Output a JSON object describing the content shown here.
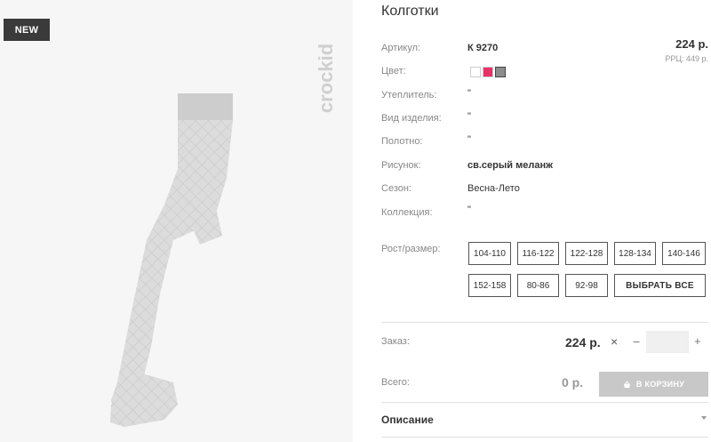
{
  "badge": {
    "label": "NEW"
  },
  "brand": {
    "logo_text": "crockid"
  },
  "product": {
    "title": "Колготки",
    "price": "224 р.",
    "rrp": "РРЦ: 449 р."
  },
  "attributes": [
    {
      "label": "Артикул:",
      "value": "К 9270"
    },
    {
      "label": "Цвет:",
      "value": ""
    },
    {
      "label": "Утеплитель:",
      "value": "\""
    },
    {
      "label": "Вид изделия:",
      "value": "\""
    },
    {
      "label": "Полотно:",
      "value": "\""
    },
    {
      "label": "Рисунок:",
      "value": "св.серый меланж"
    },
    {
      "label": "Сезон:",
      "value": "Весна-Лето"
    },
    {
      "label": "Коллекция:",
      "value": "\""
    }
  ],
  "colors": [
    {
      "name": "white",
      "hex": "#ffffff"
    },
    {
      "name": "pink",
      "hex": "#e8326a"
    },
    {
      "name": "gray",
      "hex": "#8d8d8d"
    }
  ],
  "sizes": {
    "label": "Рост/размер:",
    "options": [
      "104-110",
      "116-122",
      "122-128",
      "128-134",
      "140-146",
      "152-158",
      "80-86",
      "92-98"
    ],
    "select_all": "ВЫБРАТЬ ВСЕ"
  },
  "order": {
    "label": "Заказ:",
    "price": "224 р.",
    "times": "×",
    "minus": "−",
    "plus": "+",
    "quantity": ""
  },
  "total": {
    "label": "Всего:",
    "value": "0 р.",
    "cart_button": "В КОРЗИНУ"
  },
  "description": {
    "label": "Описание"
  }
}
